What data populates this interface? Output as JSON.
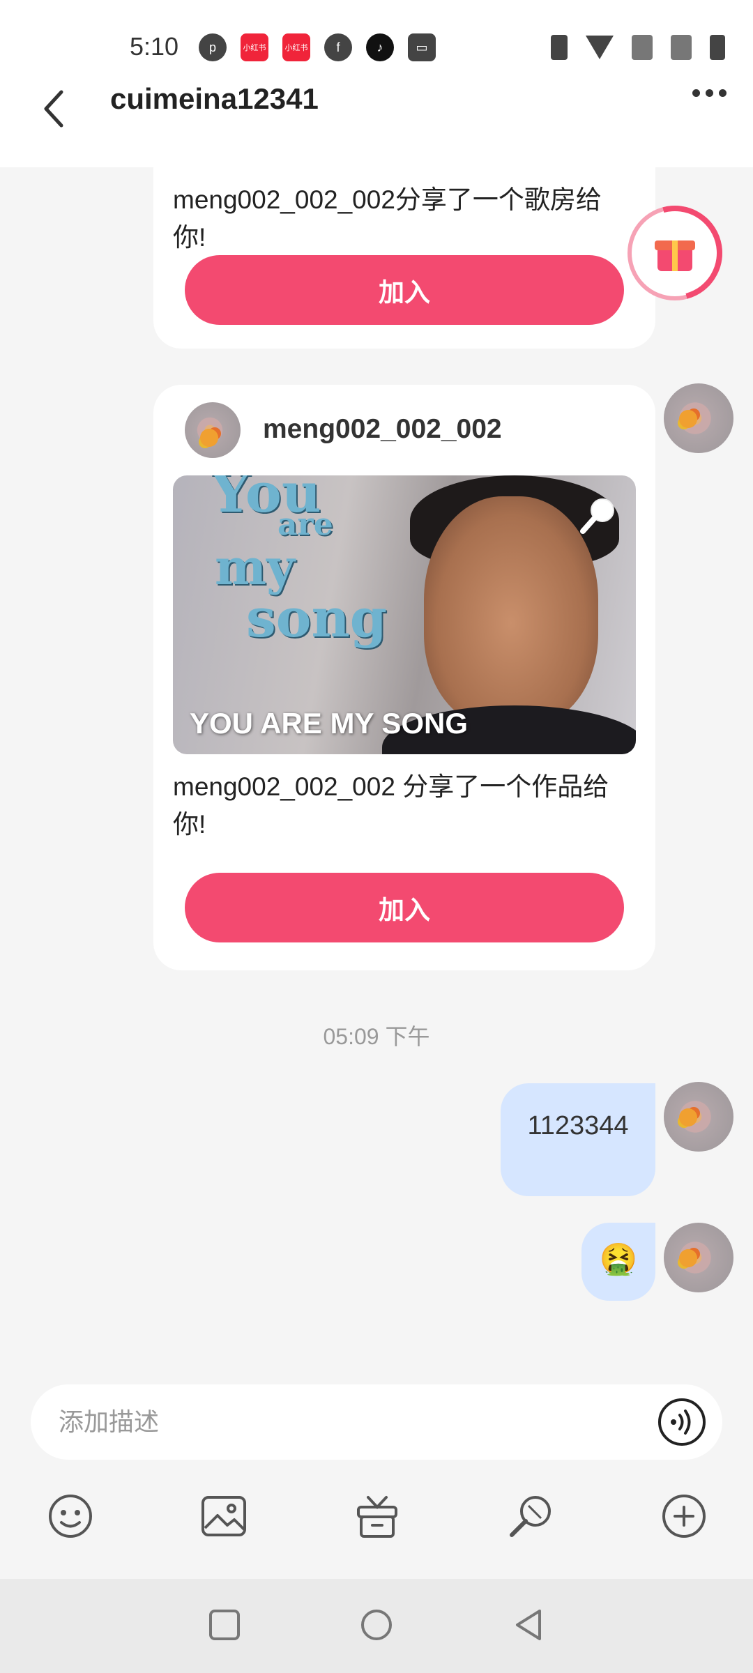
{
  "status_bar": {
    "time": "5:10",
    "left_icons": [
      "app-icon-p",
      "xiaohongshu-icon",
      "xiaohongshu-icon",
      "facebook-icon",
      "tiktok-icon",
      "wallet-icon"
    ],
    "badge_text": "小红书"
  },
  "header": {
    "title": "cuimeina12341"
  },
  "messages": {
    "room_share": {
      "text": "meng002_002_002分享了一个歌房给你!",
      "join_label": "加入"
    },
    "work_share": {
      "username": "meng002_002_002",
      "thumb_script_1": "You",
      "thumb_script_2": "are",
      "thumb_script_3": "my",
      "thumb_script_4": "song",
      "thumb_caption": "YOU ARE MY SONG",
      "text": "meng002_002_002 分享了一个作品给你!",
      "join_label": "加入"
    },
    "timestamp": "05:09 下午",
    "text_bubble": "1123344",
    "emoji_bubble": "🤮"
  },
  "input": {
    "placeholder": "添加描述"
  },
  "toolbar": {
    "items": [
      "emoji-icon",
      "image-icon",
      "gift-icon",
      "mic-icon",
      "plus-icon"
    ]
  },
  "colors": {
    "accent": "#f34a70",
    "bubble": "#d6e6ff"
  }
}
